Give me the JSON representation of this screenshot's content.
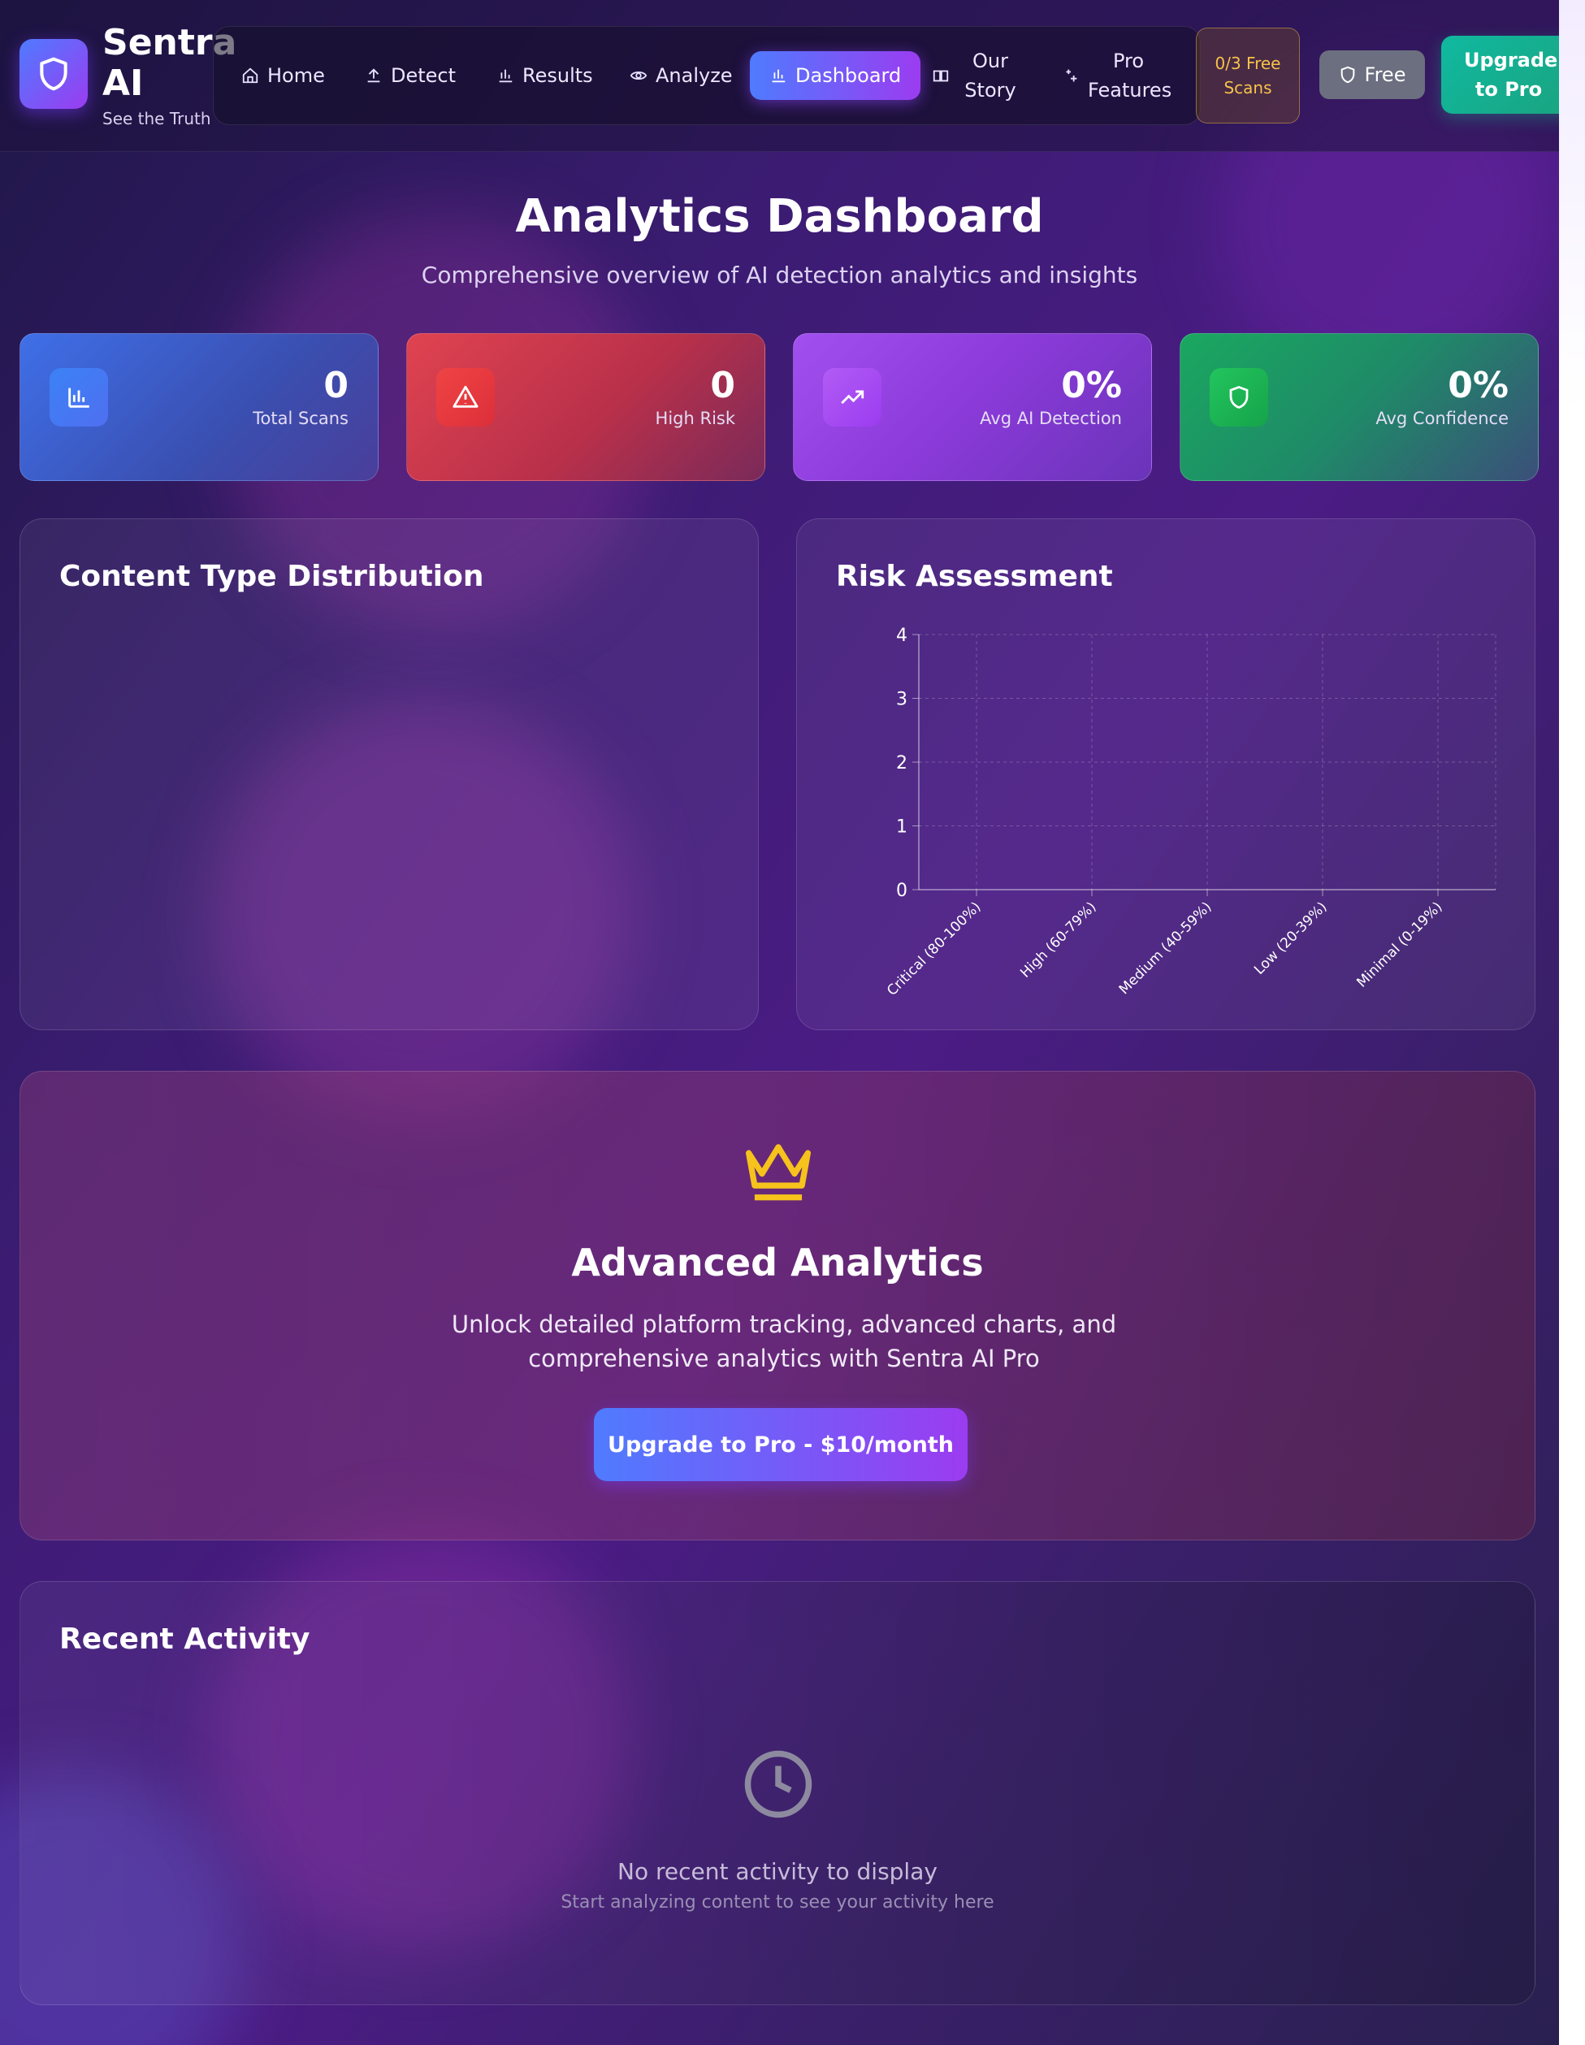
{
  "brand": {
    "name": "Sentra AI",
    "tagline": "See the Truth"
  },
  "nav": {
    "items": [
      {
        "label": "Home",
        "icon": "home-icon"
      },
      {
        "label": "Detect",
        "icon": "upload-icon"
      },
      {
        "label": "Results",
        "icon": "bar-chart-icon"
      },
      {
        "label": "Analyze",
        "icon": "eye-icon"
      },
      {
        "label": "Dashboard",
        "icon": "bar-chart-icon",
        "active": true
      },
      {
        "label": "Our Story",
        "icon": "book-icon"
      },
      {
        "label": "Pro Features",
        "icon": "sparkles-icon"
      }
    ],
    "scans_badge": "0/3 Free Scans",
    "plan_label": "Free",
    "upgrade_label": "Upgrade to Pro"
  },
  "page": {
    "title": "Analytics Dashboard",
    "subtitle": "Comprehensive overview of AI detection analytics and insights"
  },
  "stats": [
    {
      "value": "0",
      "label": "Total Scans",
      "icon": "bar-chart-icon",
      "color": "#3b82f6"
    },
    {
      "value": "0",
      "label": "High Risk",
      "icon": "alert-triangle-icon",
      "color": "#ef4444"
    },
    {
      "value": "0%",
      "label": "Avg AI Detection",
      "icon": "trending-up-icon",
      "color": "#a855f7"
    },
    {
      "value": "0%",
      "label": "Avg Confidence",
      "icon": "shield-icon",
      "color": "#22c55e"
    }
  ],
  "content_distribution": {
    "title": "Content Type Distribution"
  },
  "risk_assessment": {
    "title": "Risk Assessment"
  },
  "chart_data": {
    "type": "bar",
    "title": "Risk Assessment",
    "categories": [
      "Critical (80-100%)",
      "High (60-79%)",
      "Medium (40-59%)",
      "Low (20-39%)",
      "Minimal (0-19%)"
    ],
    "values": [
      0,
      0,
      0,
      0,
      0
    ],
    "ylim": [
      0,
      4
    ],
    "yticks": [
      0,
      1,
      2,
      3,
      4
    ],
    "xlabel": "",
    "ylabel": "",
    "grid": true
  },
  "pro": {
    "icon": "crown-icon",
    "title": "Advanced Analytics",
    "description": "Unlock detailed platform tracking, advanced charts, and comprehensive analytics with Sentra AI Pro",
    "button_label": "Upgrade to Pro - $10/month"
  },
  "activity": {
    "title": "Recent Activity",
    "icon": "clock-icon",
    "empty_title": "No recent activity to display",
    "empty_subtitle": "Start analyzing content to see your activity here"
  }
}
